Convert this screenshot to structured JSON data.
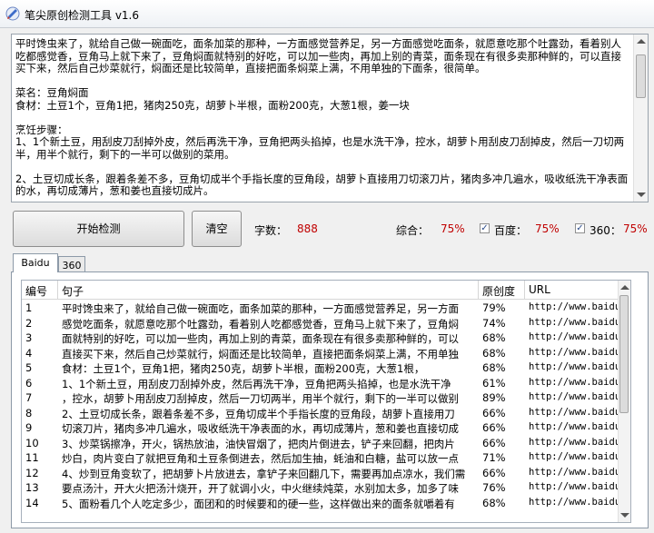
{
  "window": {
    "title": "笔尖原创检测工具 v1.6"
  },
  "input": {
    "text": "平时馋虫来了，就给自己做一碗面吃，面条加菜的那种，一方面感觉营养足，另一方面感觉吃面条，就愿意吃那个吐露劲，看着别人吃都感觉香，豆角马上就下来了，豆角焖面就特别的好吃，可以加一些肉，再加上别的青菜，面条现在有很多卖那种鲜的，可以直接买下来，然后自己炒菜就行，焖面还是比较简单，直接把面条焖菜上满，不用单独的下面条，很简单。\n\n菜名：豆角焖面\n食材：土豆1个，豆角1把，猪肉250克，胡萝卜半根，面粉200克，大葱1根，姜一块\n\n烹饪步骤：\n1、1个新土豆，用刮皮刀刮掉外皮，然后再洗干净，豆角把两头掐掉，也是水洗干净，控水，胡萝卜用刮皮刀刮掉皮，然后一刀切两半，用半个就行，剩下的一半可以做别的菜用。\n\n2、土豆切成长条，跟着条差不多，豆角切成半个手指长度的豆角段，胡萝卜直接用刀切滚刀片，猪肉多冲几遍水，吸收纸洗干净表面的水，再切成薄片，葱和姜也直接切成片。"
  },
  "toolbar": {
    "start_label": "开始检测",
    "clear_label": "清空",
    "char_count_label": "字数：",
    "char_count_value": "888",
    "overall_label": "综合：",
    "overall_value": "75%",
    "baidu_label": "百度：",
    "baidu_value": "75%",
    "baidu_checked": "✓",
    "s360_label": "360：",
    "s360_value": "75%",
    "s360_checked": "✓"
  },
  "tabs": [
    {
      "label": "Baidu"
    },
    {
      "label": "360"
    }
  ],
  "table": {
    "headers": {
      "no": "编号",
      "sentence": "句子",
      "originality": "原创度",
      "url": "URL"
    },
    "rows": [
      {
        "no": "1",
        "sentence": "平时馋虫来了，就给自己做一碗面吃，面条加菜的那种，一方面感觉营养足，另一方面",
        "originality": "79%",
        "url": "http://www.baidu."
      },
      {
        "no": "2",
        "sentence": "感觉吃面条，就愿意吃那个吐露劲，看着别人吃都感觉香，豆角马上就下来了，豆角焖",
        "originality": "74%",
        "url": "http://www.baidu."
      },
      {
        "no": "3",
        "sentence": "面就特别的好吃，可以加一些肉，再加上别的青菜，面条现在有很多卖那种鲜的，可以",
        "originality": "68%",
        "url": "http://www.baidu."
      },
      {
        "no": "4",
        "sentence": "直接买下来，然后自己炒菜就行，焖面还是比较简单，直接把面条焖菜上满，不用单独",
        "originality": "68%",
        "url": "http://www.baidu."
      },
      {
        "no": "5",
        "sentence": "食材：土豆1个，豆角1把，猪肉250克，胡萝卜半根，面粉200克，大葱1根，",
        "originality": "68%",
        "url": "http://www.baidu."
      },
      {
        "no": "6",
        "sentence": "1、1个新土豆，用刮皮刀刮掉外皮，然后再洗干净，豆角把两头掐掉，也是水洗干净",
        "originality": "61%",
        "url": "http://www.baidu."
      },
      {
        "no": "7",
        "sentence": "，控水，胡萝卜用刮皮刀刮掉皮，然后一刀切两半，用半个就行，剩下的一半可以做别",
        "originality": "89%",
        "url": "http://www.baidu."
      },
      {
        "no": "8",
        "sentence": "2、土豆切成长条，跟着条差不多，豆角切成半个手指长度的豆角段，胡萝卜直接用刀",
        "originality": "66%",
        "url": "http://www.baidu."
      },
      {
        "no": "9",
        "sentence": "切滚刀片，猪肉多冲几遍水，吸收纸洗干净表面的水，再切成薄片，葱和姜也直接切成",
        "originality": "66%",
        "url": "http://www.baidu."
      },
      {
        "no": "10",
        "sentence": "3、炒菜锅擦净，开火，锅热放油，油快冒烟了，把肉片倒进去，铲子来回翻，把肉片",
        "originality": "66%",
        "url": "http://www.baidu."
      },
      {
        "no": "11",
        "sentence": "炒白，肉片变白了就把豆角和土豆条倒进去，然后加生抽，蚝油和白糖，盐可以放一点",
        "originality": "71%",
        "url": "http://www.baidu."
      },
      {
        "no": "12",
        "sentence": "4、炒到豆角变软了，把胡萝卜片放进去，拿铲子来回翻几下，需要再加点凉水，我们需",
        "originality": "66%",
        "url": "http://www.baidu."
      },
      {
        "no": "13",
        "sentence": "要点汤汁，开大火把汤汁烧开，开了就调小火，中火继续炖菜，水别加太多，加多了味",
        "originality": "76%",
        "url": "http://www.baidu."
      },
      {
        "no": "14",
        "sentence": "5、面粉看几个人吃定多少，面团和的时候要和的硬一些，这样做出来的面条就嚼着有",
        "originality": "68%",
        "url": "http://www.baidu."
      }
    ]
  }
}
